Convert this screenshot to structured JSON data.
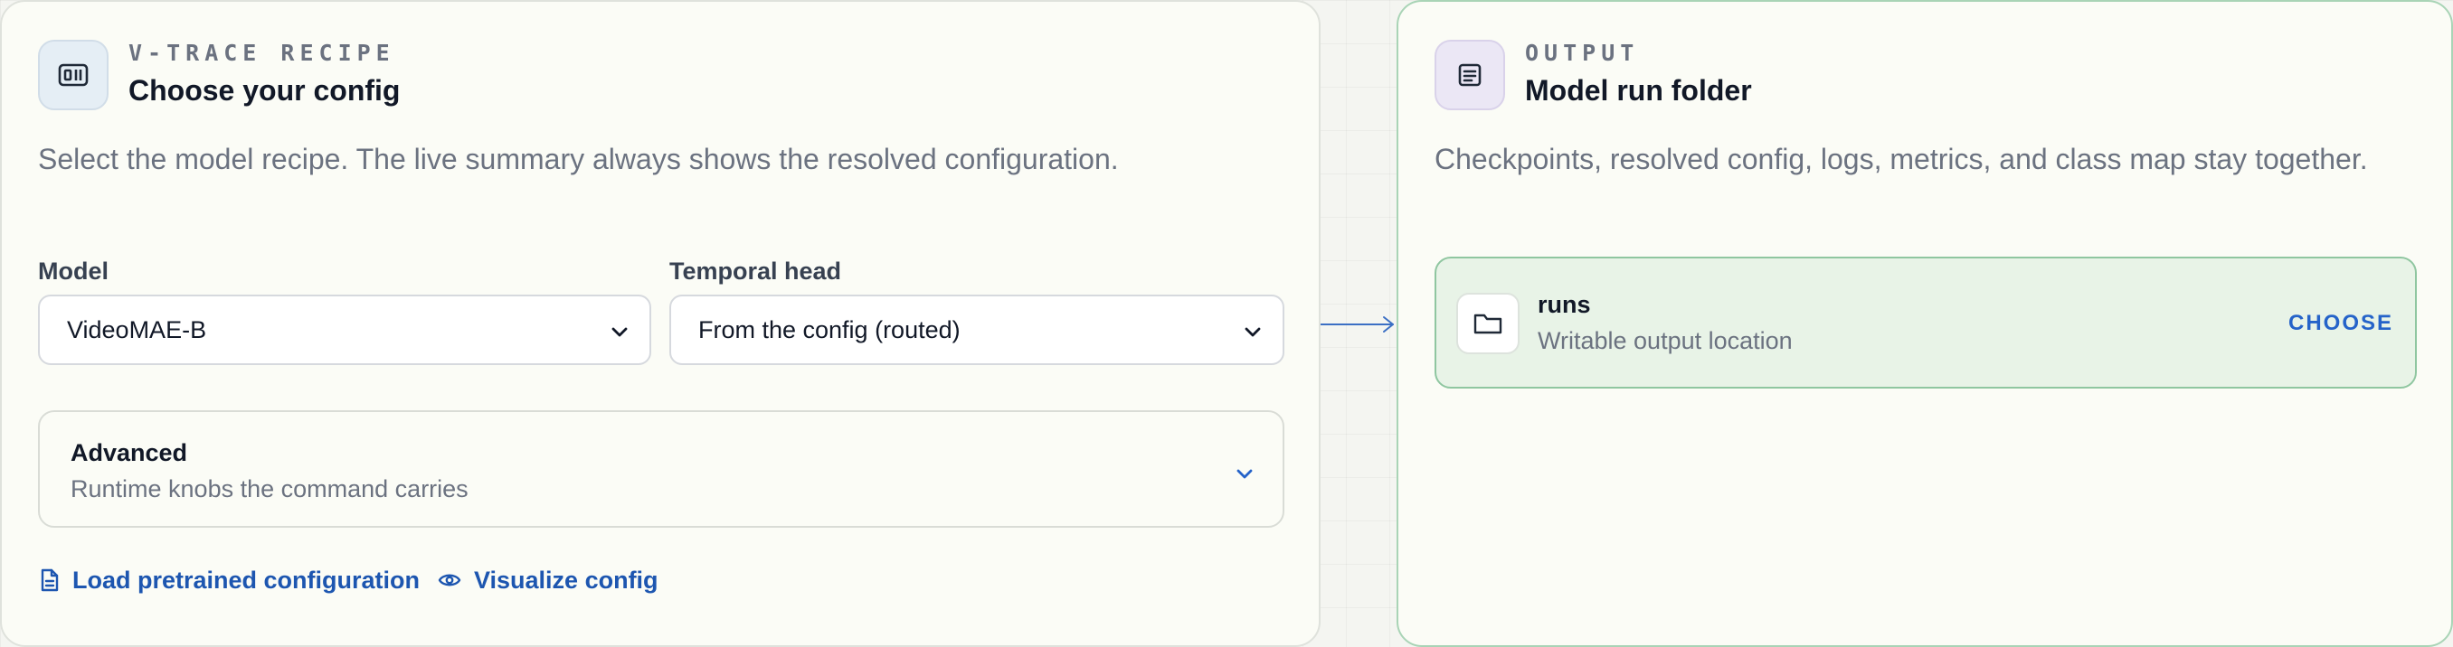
{
  "recipe": {
    "eyebrow": "V-TRACE RECIPE",
    "title": "Choose your config",
    "description": "Select the model recipe. The live summary always shows the resolved configuration.",
    "icon": "config-panel-icon",
    "model": {
      "label": "Model",
      "value": "VideoMAE-B"
    },
    "temporal_head": {
      "label": "Temporal head",
      "value": "From the config (routed)"
    },
    "advanced": {
      "title": "Advanced",
      "subtitle": "Runtime knobs the command carries",
      "expanded": false
    },
    "links": {
      "load_pretrained": "Load pretrained configuration",
      "visualize": "Visualize config"
    }
  },
  "output": {
    "eyebrow": "OUTPUT",
    "title": "Model run folder",
    "description": "Checkpoints, resolved config, logs, metrics, and class map stay together.",
    "icon": "document-icon",
    "folder": {
      "name": "runs",
      "subtitle": "Writable output location",
      "action": "CHOOSE"
    }
  },
  "colors": {
    "accent_link": "#1d56b0",
    "choose_blue": "#2563c9",
    "output_border": "#8fc6a0",
    "output_fill": "#e8f3e7",
    "card_bg": "#fbfcf6"
  }
}
